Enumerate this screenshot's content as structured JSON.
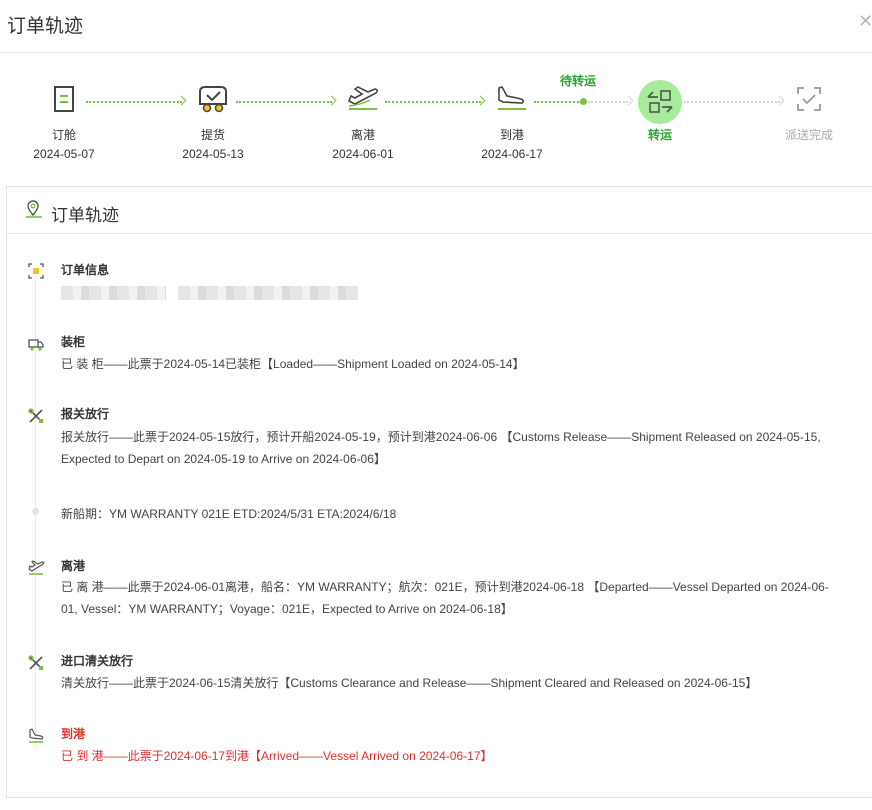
{
  "dialog": {
    "title": "订单轨迹",
    "close_icon": "close-icon"
  },
  "stepper": {
    "pending_label": "待转运",
    "steps": [
      {
        "label": "订舱",
        "date": "2024-05-07",
        "icon": "document-icon"
      },
      {
        "label": "提货",
        "date": "2024-05-13",
        "icon": "pickup-truck-icon"
      },
      {
        "label": "离港",
        "date": "2024-06-01",
        "icon": "plane-departure-icon"
      },
      {
        "label": "到港",
        "date": "2024-06-17",
        "icon": "plane-arrival-icon"
      },
      {
        "label": "转运",
        "date": "",
        "icon": "transfer-icon",
        "state": "active"
      },
      {
        "label": "派送完成",
        "date": "",
        "icon": "delivery-done-icon",
        "state": "pending"
      }
    ],
    "colors": {
      "done": "#7bc142",
      "active": "#2aa42e",
      "active_bg": "#a6ec9a",
      "pending": "#d5d5d5"
    }
  },
  "panel": {
    "title": "订单轨迹",
    "events": [
      {
        "title": "订单信息",
        "body": "",
        "icon": "order-info-icon"
      },
      {
        "title": "装柜",
        "body": "已 装 柜——此票于2024-05-14已装柜【Loaded——Shipment Loaded on 2024-05-14】",
        "icon": "truck-icon"
      },
      {
        "title": "报关放行",
        "body": "报关放行——此票于2024-05-15放行，预计开船2024-05-19，预计到港2024-06-06 【Customs Release——Shipment Released on 2024-05-15, Expected to Depart on 2024-05-19 to Arrive on 2024-06-06】",
        "icon": "customs-tools-icon"
      },
      {
        "title": "",
        "body": "新船期：YM WARRANTY 021E ETD:2024/5/31 ETA:2024/6/18",
        "icon": ""
      },
      {
        "title": "离港",
        "body": "已 离 港——此票于2024-06-01离港，船名：YM WARRANTY；航次：021E，预计到港2024-06-18 【Departed——Vessel Departed on 2024-06-01, Vessel：YM WARRANTY；Voyage：021E，Expected to Arrive on 2024-06-18】",
        "icon": "plane-departure-icon"
      },
      {
        "title": "进口清关放行",
        "body": "清关放行——此票于2024-06-15清关放行【Customs Clearance and Release——Shipment Cleared and Released on 2024-06-15】",
        "icon": "customs-tools-icon"
      },
      {
        "title": "到港",
        "body": "已 到 港——此票于2024-06-17到港【Arrived——Vessel Arrived on 2024-06-17】",
        "icon": "plane-arrival-icon",
        "highlight": "#e0302e"
      }
    ]
  }
}
